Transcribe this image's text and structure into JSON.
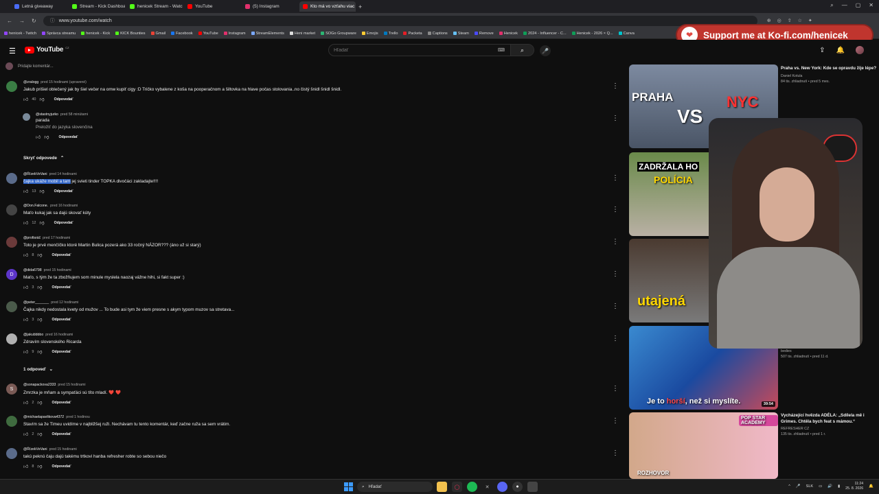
{
  "browser": {
    "tabs": [
      {
        "label": "Letná giveaway",
        "color": "#4a6cf7",
        "active": false
      },
      {
        "label": "Stream - Kick Dashboard",
        "color": "#53fc18",
        "active": false
      },
      {
        "label": "henicek Stream - Watch L",
        "color": "#53fc18",
        "active": false
      },
      {
        "label": "YouTube",
        "color": "#ff0000",
        "active": false
      },
      {
        "label": "(5) Instagram",
        "color": "#e1306c",
        "active": false
      },
      {
        "label": "Kto má vo vzťahu viac zav",
        "color": "#ff0000",
        "active": true
      }
    ],
    "url": "www.youtube.com/watch",
    "bookmarks": [
      {
        "label": "henicek - Twitch",
        "color": "#9146ff"
      },
      {
        "label": "Správca streamu",
        "color": "#9146ff"
      },
      {
        "label": "henicek - Kick",
        "color": "#53fc18"
      },
      {
        "label": "KICK Bounties",
        "color": "#53fc18"
      },
      {
        "label": "Gmail",
        "color": "#ea4335"
      },
      {
        "label": "Facebook",
        "color": "#1877f2"
      },
      {
        "label": "YouTube",
        "color": "#ff0000"
      },
      {
        "label": "Instagram",
        "color": "#e1306c"
      },
      {
        "label": "StreamElements",
        "color": "#7aa8ff"
      },
      {
        "label": "Heni market",
        "color": "#dddddd"
      },
      {
        "label": "SOGo Groupware",
        "color": "#2bb673"
      },
      {
        "label": "Emojis",
        "color": "#ffcc33"
      },
      {
        "label": "Trello",
        "color": "#0079bf"
      },
      {
        "label": "Packeta",
        "color": "#e41e26"
      },
      {
        "label": "Captions",
        "color": "#8a8a8a"
      },
      {
        "label": "Steam",
        "color": "#66c0f4"
      },
      {
        "label": "Remove",
        "color": "#4a4aff"
      },
      {
        "label": "Henicek",
        "color": "#e1306c"
      },
      {
        "label": "2024 - Influencer - C...",
        "color": "#0f9d58"
      },
      {
        "label": "Henicek - 2026 × Q...",
        "color": "#0f9d58"
      },
      {
        "label": "Canva",
        "color": "#00c4cc"
      }
    ]
  },
  "kofi": {
    "text": "Support me at Ko-fi.com/henicek"
  },
  "youtube": {
    "logo_text": "YouTube",
    "country": "CZ",
    "search_placeholder": "Hľadať"
  },
  "comments_section": {
    "add_comment_placeholder": "Pridajte komentár...",
    "comments": [
      {
        "author": "@zralogg",
        "time": "pred 15 hodinami (upravené)",
        "text": "Jakub prišiel oblečený jak by šiel večer na omw kupiť cigy :D Tričko vybalene z koša na pooperačnom a šiltovka na hlave počas stolovania..no čistý šnidl šnidl šnidl.",
        "likes": "40",
        "avatar_color": "#3a7d44",
        "avatar_letter": ""
      },
      {
        "author": "@stastnyjurko",
        "time": "pred 58 minútami",
        "text": "parada",
        "translate": "Preložiť do jazyka slovenčina",
        "likes": "",
        "avatar_color": "#7a8a9a",
        "avatar_letter": "",
        "nested": true
      },
      {
        "author": "@ŘízekVeVani",
        "time": "pred 14 hodinami",
        "text_highlight": "čajka ukáže mobil a tam",
        "text": " jej svieti tinder TOPKA divočáci zakladajte!!!!",
        "likes": "13",
        "avatar_color": "#5a6b8a",
        "avatar_letter": ""
      },
      {
        "author": "@Don.Falcone.",
        "time": "pred 16 hodinami",
        "text": "Maťo kukaj jak sa dajú skovať kúty",
        "likes": "12",
        "avatar_color": "#444444",
        "avatar_letter": ""
      },
      {
        "author": "@profisráč",
        "time": "pred 17 hodinami",
        "text": "Toto je prvé menčíčko ktoré Martin Bulica pozerá ako 33 ročný NÁZOR??? (áno už si starý)",
        "likes": "8",
        "avatar_color": "#6b3a3a",
        "avatar_letter": ""
      },
      {
        "author": "@dida6798",
        "time": "pred 15 hodinami",
        "text": "Maťo, s tým že ta zbožňujem som minule myslela naozaj vážne hihi, si fakt super :)",
        "likes": "3",
        "avatar_color": "#5c35c9",
        "avatar_letter": "D"
      },
      {
        "author": "@peter_______",
        "time": "pred 12 hodinami",
        "text": "Čajka nikdy nedostala kvety od mužov ... To bude asi tym že viem presne s akym typom muzov sa stretava...",
        "likes": "3",
        "avatar_color": "#4a5a4a",
        "avatar_letter": ""
      },
      {
        "author": "@jakubbbbo",
        "time": "pred 16 hodinami",
        "text": "Zdravím slovenského Ricarda",
        "likes": "9",
        "avatar_color": "#b0b0b0",
        "avatar_letter": ""
      },
      {
        "author": "@sonapackova2333",
        "time": "pred 15 hodinami",
        "text": "Zmrzka je mňam a sympaťáci sú títo mladí.",
        "hearts": "❤️ ❤️",
        "likes": "2",
        "avatar_color": "#7a5a55",
        "avatar_letter": "S"
      },
      {
        "author": "@michaelapavlikova4372",
        "time": "pred 1 hodinou",
        "text": "Stavím sa že Timeu uvidíme v najbližšej ruži. Nechávam tu tento komentár, keď začne ruža sa sem vrátim.",
        "likes": "2",
        "avatar_color": "#3f6b3f",
        "avatar_letter": ""
      },
      {
        "author": "@ŘízekVeVani",
        "time": "pred 15 hodinami",
        "text": "takú peknú čaju dajú takému trtkovi hanba refresher robte so sebou niečo",
        "likes": "8",
        "avatar_color": "#5a6b8a",
        "avatar_letter": ""
      }
    ],
    "reply_label": "Odpovedať",
    "hide_replies": "Skryť odpovede",
    "one_reply": "1 odpoveď"
  },
  "sidebar": {
    "videos": [
      {
        "title": "Praha vs. New York: Kde se opravdu žije lépe?",
        "channel": "Daniel Kotula",
        "views": "84 tis. zhliadnutí • pred 5 mes.",
        "thumb_text": "PRAHA VS NYC"
      },
      {
        "title": "",
        "channel": "",
        "views": "",
        "thumb_text": "ZADRŽALA HO POLÍCIA"
      },
      {
        "title": "",
        "channel": "",
        "views": "",
        "thumb_text": "utajená"
      },
      {
        "title": "",
        "channel": "bedies",
        "views": "507 tis. zhliadnutí • pred 11 d.",
        "thumb_text": "Je to horší, než si myslíte.",
        "duration": "39:54"
      },
      {
        "title": "Vycházející hvězda ADÉLA: „Sdílela mě i Grimes. Chtěla bych feat s mámou.“",
        "channel": "REFRESHER CZ",
        "views": "135 tis. zhliadnutí • pred 1 r.",
        "thumb_text": "ROZHOVOR"
      }
    ],
    "popstar_badge": "POP STAR ACADEMY"
  },
  "taskbar": {
    "search_label": "Hľadať",
    "lang": "SLK",
    "time": "11:24",
    "date": "25. 8. 2026"
  }
}
